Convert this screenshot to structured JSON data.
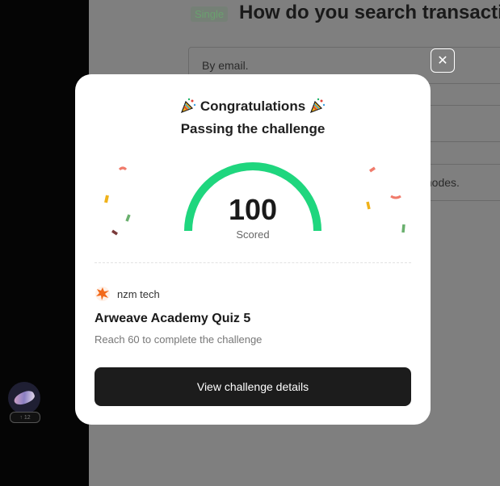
{
  "app": {
    "question_type": "Single",
    "question_title": "How do you search transactio",
    "options": [
      {
        "text": "By email."
      },
      {
        "text": ""
      },
      {
        "text": ""
      },
      {
        "text": "y nodes."
      }
    ],
    "user_level": "↑ 12"
  },
  "dialog": {
    "close_symbol": "✕",
    "title": "Congratulations",
    "subtitle": "Passing the challenge",
    "score": "100",
    "score_label": "Scored",
    "score_fraction": 1.0,
    "gauge_color": "#1fd67e",
    "creator_name": "nzm tech",
    "challenge_title": "Arweave Academy Quiz 5",
    "challenge_description": "Reach 60 to complete the challenge",
    "button_label": "View challenge details"
  },
  "icons": {
    "party_popper": "party-popper-icon",
    "close": "close-icon",
    "creator_avatar": "orange-blob-avatar"
  }
}
